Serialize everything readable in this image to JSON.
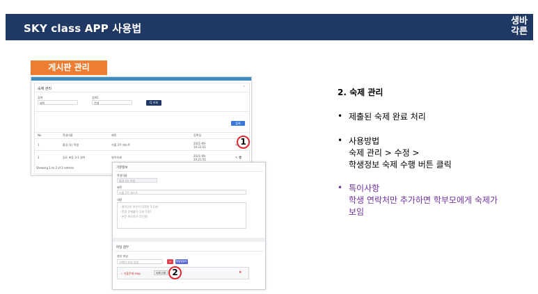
{
  "header": {
    "title": "SKY class APP 사용법",
    "logo_line1": "생바",
    "logo_line2": "각른"
  },
  "section_tag": "게시판 관리",
  "shot1": {
    "card_title": "숙제 관리",
    "collapse": "˄",
    "filter_label_1": "검색",
    "filter_label_2": "검색1",
    "filter_value_1": "제목",
    "filter_value_2": "전체",
    "search_button": "Q 조회",
    "add_button": "등록",
    "columns": [
      "No",
      "학생이름",
      "제목",
      "등록일",
      ""
    ],
    "rows": [
      {
        "no": "1",
        "name": "홍길 (1) 학생",
        "title": "기출 2주 테스트",
        "date": "2021-09-10:21:51",
        "actions": "✎ 🗑"
      },
      {
        "no": "1",
        "name": "김도 초등 3-1 영어",
        "title": "영어숙제",
        "date": "2021-09-10:21:51",
        "actions": "✎ 🗑"
      }
    ],
    "footer": "Showing 1 to 2 of 2 entries"
  },
  "shot2": {
    "section1_title": "기본정보",
    "field1_label": "학생이름",
    "field1_value": "홍길 (1) 학생",
    "field2_label": "제목",
    "field2_value": "기출 2주 테스트",
    "field3_label": "내용",
    "content_lines": [
      "- 영어단어 외우기 (1학년 1-1과)",
      "- 문법 문제풀이 (1과 문장)",
      "- 본문 해석하기 (1단원)"
    ],
    "section2_title": "파일 첨부",
    "file_label": "첨부 파일",
    "file_select": "선택된 파일 없음",
    "add_btn": "+",
    "upload_btn": "파일업로드",
    "file_entry": "✓ 기출문제.hwp",
    "file_entry_chip": "숙제 수행",
    "delete_icon": "✖"
  },
  "callouts": [
    "1",
    "2"
  ],
  "panel": {
    "heading": "2. 숙제 관리",
    "bullet1": "제출된 숙제 완료 처리",
    "bullet2_lines": [
      "사용방법",
      "숙제 관리 > 수정 >",
      "학생정보 숙제 수행 버튼 클릭"
    ],
    "bullet3_lines": [
      "특이사항",
      "학생 연락처만 추가하면 학부모에게 숙제가",
      "보임"
    ],
    "bullet_symbol": "•"
  },
  "colors": {
    "header_bg": "#203864",
    "tag_bg": "#ed7d31",
    "callout_border": "#e0262d",
    "purple_text": "#7030a0"
  }
}
